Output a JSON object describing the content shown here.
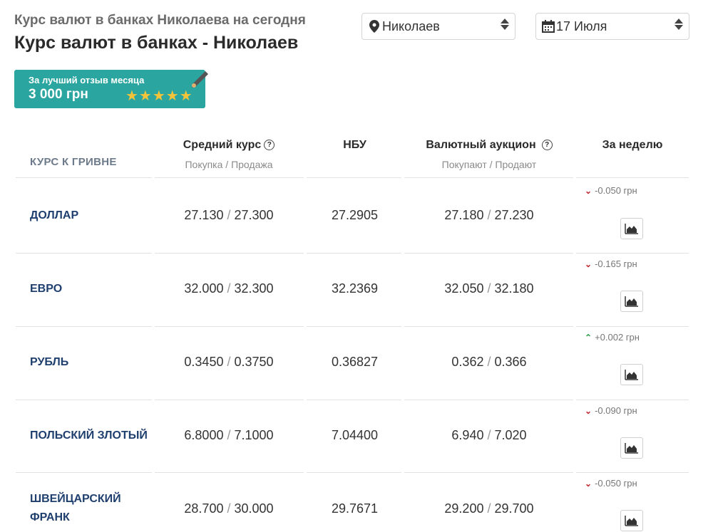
{
  "header": {
    "subtitle": "Курс валют в банках Николаева на сегодня",
    "title": "Курс валют в банках - Николаев"
  },
  "filters": {
    "city": "Николаев",
    "date": "17 Июля"
  },
  "promo": {
    "line1": "За лучший отзыв месяца",
    "line2": "3 000 грн",
    "stars": "★★★★★"
  },
  "table": {
    "col_kurs": "КУРС К ГРИВНЕ",
    "col_avg": "Средний курс",
    "col_avg_sub": "Покупка / Продажа",
    "col_nbu": "НБУ",
    "col_auction": "Валютный аукцион",
    "col_auction_sub": "Покупают / Продают",
    "col_week": "За неделю",
    "sep": "/",
    "rows": [
      {
        "name": "ДОЛЛАР",
        "buy": "27.130",
        "sell": "27.300",
        "nbu": "27.2905",
        "a_buy": "27.180",
        "a_sell": "27.230",
        "delta": "-0.050 грн",
        "dir": "down"
      },
      {
        "name": "ЕВРО",
        "buy": "32.000",
        "sell": "32.300",
        "nbu": "32.2369",
        "a_buy": "32.050",
        "a_sell": "32.180",
        "delta": "-0.165 грн",
        "dir": "down"
      },
      {
        "name": "РУБЛЬ",
        "buy": "0.3450",
        "sell": "0.3750",
        "nbu": "0.36827",
        "a_buy": "0.362",
        "a_sell": "0.366",
        "delta": "+0.002 грн",
        "dir": "up"
      },
      {
        "name": "ПОЛЬСКИЙ ЗЛОТЫЙ",
        "buy": "6.8000",
        "sell": "7.1000",
        "nbu": "7.04400",
        "a_buy": "6.940",
        "a_sell": "7.020",
        "delta": "-0.090 грн",
        "dir": "down"
      },
      {
        "name_line1": "ШВЕЙЦАРСКИЙ",
        "name_line2": "ФРАНК",
        "buy": "28.700",
        "sell": "30.000",
        "nbu": "29.7671",
        "a_buy": "29.200",
        "a_sell": "29.700",
        "delta": "-0.050 грн",
        "dir": "down"
      }
    ]
  },
  "colors": {
    "promo_bg": "#2aa5a0",
    "currency_name": "#1f3f6e",
    "down": "#c0262d",
    "up": "#2d9b4a"
  }
}
